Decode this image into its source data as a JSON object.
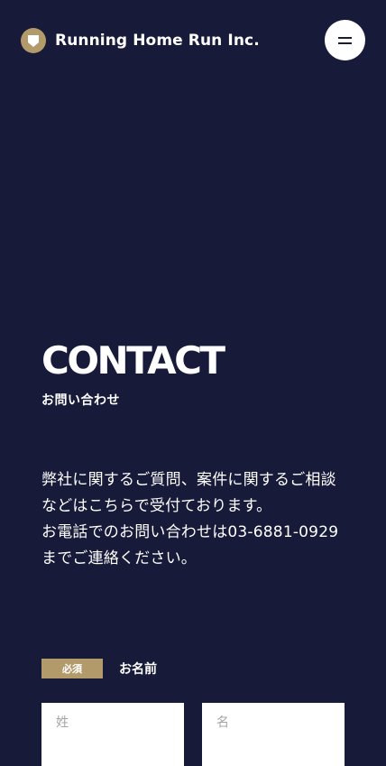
{
  "header": {
    "logo_text": "Running Home Run Inc.",
    "logo_icon": "speech-shield-icon",
    "menu_icon": "hamburger-icon",
    "brand_color": "#b39a6a",
    "background_color": "#171a38"
  },
  "hero": {
    "title": "CONTACT",
    "subtitle": "お問い合わせ"
  },
  "intro": {
    "paragraph1": "弊社に関するご質問、案件に関するご相談などはこちらで受付ております。",
    "paragraph2": "お電話でのお問い合わせは03-6881-0929までご連絡ください。"
  },
  "form": {
    "name_field": {
      "required_badge": "必須",
      "label": "お名前",
      "last_name_placeholder": "姓",
      "first_name_placeholder": "名"
    }
  }
}
